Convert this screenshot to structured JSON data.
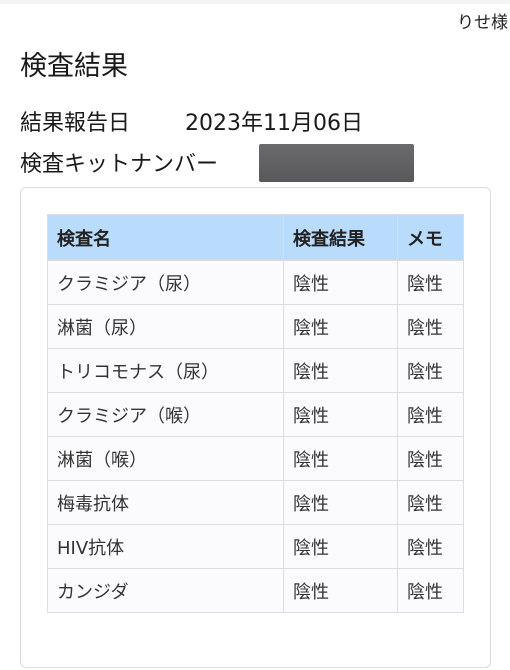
{
  "header": {
    "user_name": "りせ様"
  },
  "page": {
    "title": "検査結果",
    "report_date_label": "結果報告日",
    "report_date_value": "2023年11月06日",
    "kit_number_label": "検査キットナンバー",
    "kit_number_value": "[redacted]"
  },
  "table": {
    "headers": [
      "検査名",
      "検査結果",
      "メモ"
    ],
    "rows": [
      {
        "name": "クラミジア（尿）",
        "result": "陰性",
        "memo": "陰性"
      },
      {
        "name": "淋菌（尿）",
        "result": "陰性",
        "memo": "陰性"
      },
      {
        "name": "トリコモナス（尿）",
        "result": "陰性",
        "memo": "陰性"
      },
      {
        "name": "クラミジア（喉）",
        "result": "陰性",
        "memo": "陰性"
      },
      {
        "name": "淋菌（喉）",
        "result": "陰性",
        "memo": "陰性"
      },
      {
        "name": "梅毒抗体",
        "result": "陰性",
        "memo": "陰性"
      },
      {
        "name": "HIV抗体",
        "result": "陰性",
        "memo": "陰性"
      },
      {
        "name": "カンジダ",
        "result": "陰性",
        "memo": "陰性"
      }
    ]
  },
  "colors": {
    "header_bg": "#b9dcfd",
    "row_bg": "#fbfbfd",
    "border": "#dcdde0"
  }
}
